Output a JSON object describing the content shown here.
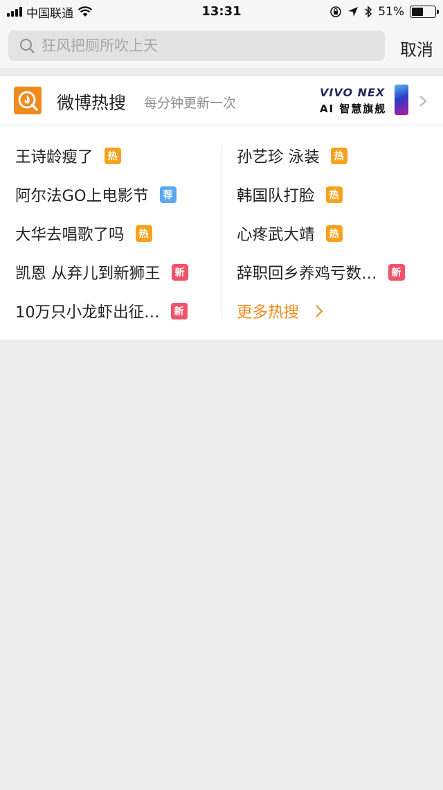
{
  "status_bar": {
    "carrier": "中国联通",
    "time": "13:31",
    "battery_percent_text": "51%",
    "battery_level": 0.51
  },
  "search": {
    "placeholder": "狂风把厕所吹上天",
    "cancel_label": "取消"
  },
  "hot_search": {
    "title": "微博热搜",
    "subtitle": "每分钟更新一次",
    "ad": {
      "line1": "VIVO NEX",
      "line2": "AI 智慧旗舰"
    },
    "left_items": [
      {
        "label": "王诗龄瘦了",
        "badge": "热",
        "badge_type": "hot"
      },
      {
        "label": "阿尔法GO上电影节",
        "badge": "荐",
        "badge_type": "rec"
      },
      {
        "label": "大华去唱歌了吗",
        "badge": "热",
        "badge_type": "hot"
      },
      {
        "label": "凯恩 从弃儿到新狮王",
        "badge": "新",
        "badge_type": "new"
      },
      {
        "label": "10万只小龙虾出征…",
        "badge": "新",
        "badge_type": "new"
      }
    ],
    "right_items": [
      {
        "label": "孙艺珍 泳装",
        "badge": "热",
        "badge_type": "hot"
      },
      {
        "label": "韩国队打脸",
        "badge": "热",
        "badge_type": "hot"
      },
      {
        "label": "心疼武大靖",
        "badge": "热",
        "badge_type": "hot"
      },
      {
        "label": "辞职回乡养鸡亏数…",
        "badge": "新",
        "badge_type": "new"
      }
    ],
    "more_label": "更多热搜"
  },
  "colors": {
    "accent_orange": "#f08a1c",
    "badge_hot": "#f6a21d",
    "badge_rec": "#5aa9f0",
    "badge_new": "#f0536a",
    "page_background": "#ececec"
  },
  "icons": [
    "signal-icon",
    "wifi-icon",
    "lock-rotation-icon",
    "location-arrow-icon",
    "bluetooth-icon",
    "battery-icon",
    "search-icon",
    "hot-search-logo-icon",
    "chevron-right-icon"
  ]
}
